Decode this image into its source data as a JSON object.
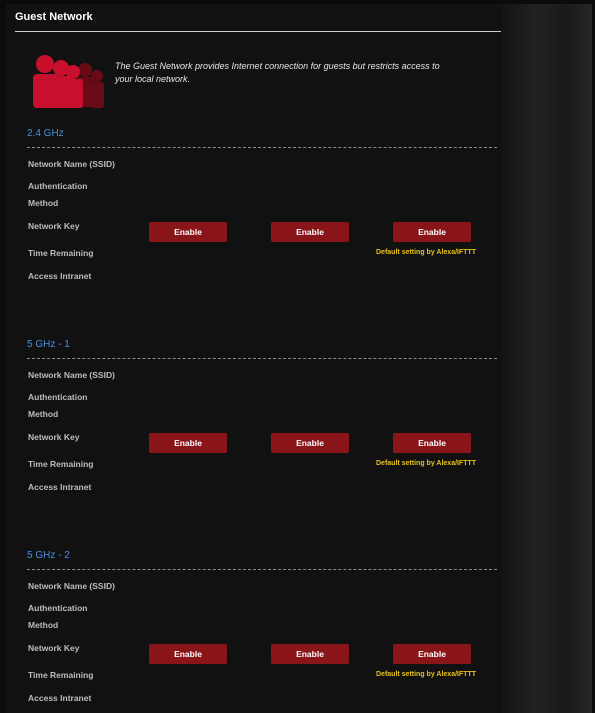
{
  "page": {
    "title": "Guest Network",
    "description_line1": "The Guest Network provides Internet connection for guests but restricts access to",
    "description_line2": "your local network."
  },
  "sections": [
    {
      "title": "2.4 GHz",
      "labels": [
        "Network Name (SSID)",
        "Authentication",
        "Method",
        "Network Key",
        "Time Remaining",
        "Access Intranet"
      ],
      "buttons": [
        "Enable",
        "Enable",
        "Enable"
      ],
      "note": "Default setting by Alexa/IFTTT"
    },
    {
      "title": "5 GHz - 1",
      "labels": [
        "Network Name (SSID)",
        "Authentication",
        "Method",
        "Network Key",
        "Time Remaining",
        "Access Intranet"
      ],
      "buttons": [
        "Enable",
        "Enable",
        "Enable"
      ],
      "note": "Default setting by Alexa/IFTTT"
    },
    {
      "title": "5 GHz - 2",
      "labels": [
        "Network Name (SSID)",
        "Authentication",
        "Method",
        "Network Key",
        "Time Remaining",
        "Access Intranet"
      ],
      "buttons": [
        "Enable",
        "Enable",
        "Enable"
      ],
      "note": "Default setting by Alexa/IFTTT"
    }
  ],
  "icons": {
    "hero": "guest-users-icon"
  },
  "colors": {
    "accent": "#4a90d9",
    "button": "#8a1519",
    "note": "#e8c21c",
    "icon": "#c8102e"
  }
}
